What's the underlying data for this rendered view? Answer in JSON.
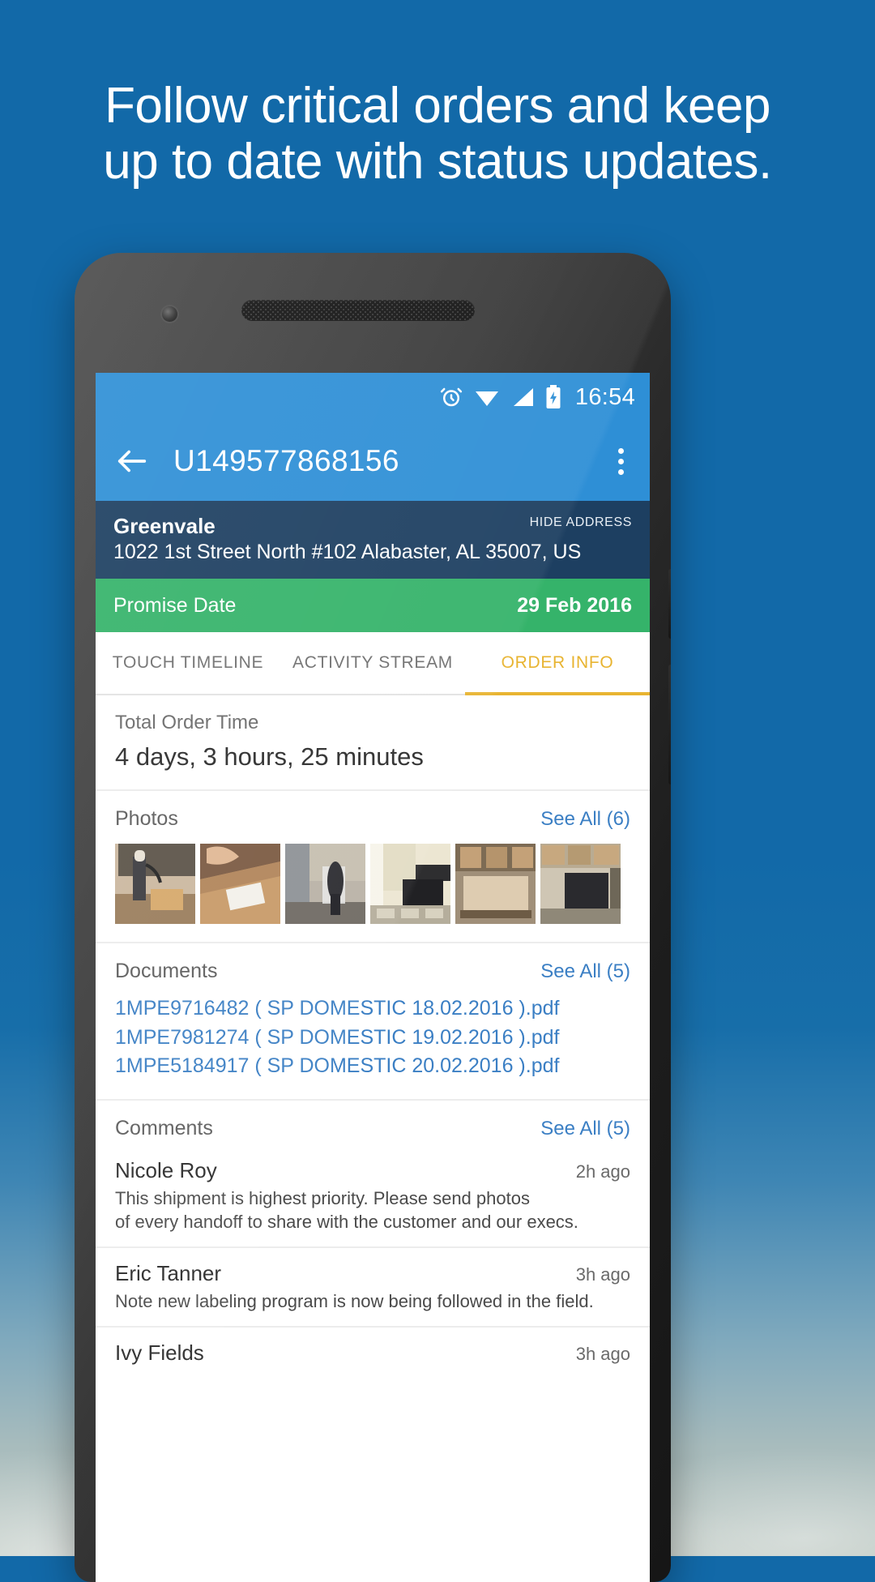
{
  "marketing": {
    "headline_line1": "Follow critical orders and keep",
    "headline_line2": "up to date with status updates."
  },
  "colors": {
    "background": "#1269a8",
    "toolbar": "#2e8fd6",
    "address_bar": "#1d3f61",
    "promise_bar": "#35b36a",
    "accent_tab": "#e8b431",
    "link": "#3b7fc4"
  },
  "statusbar": {
    "alarm_icon": "alarm-clock-icon",
    "wifi_icon": "wifi-icon",
    "signal_icon": "cell-signal-icon",
    "battery_icon": "battery-charging-icon",
    "time": "16:54"
  },
  "toolbar": {
    "back_icon": "back-arrow-icon",
    "title": "U149577868156",
    "overflow_icon": "overflow-menu-icon"
  },
  "address": {
    "name": "Greenvale",
    "line": "1022 1st Street North #102 Alabaster, AL 35007, US",
    "hide_label": "HIDE ADDRESS"
  },
  "promise": {
    "label": "Promise Date",
    "value": "29 Feb 2016"
  },
  "tabs": [
    {
      "label": "TOUCH TIMELINE",
      "active": false
    },
    {
      "label": "ACTIVITY STREAM",
      "active": false
    },
    {
      "label": "ORDER INFO",
      "active": true
    }
  ],
  "total_order_time": {
    "label": "Total Order Time",
    "value": "4 days, 3 hours, 25 minutes"
  },
  "photos": {
    "title": "Photos",
    "see_all": "See All (6)",
    "items": [
      {
        "name": "photo-pallet-jack"
      },
      {
        "name": "photo-box-label"
      },
      {
        "name": "photo-warehouse-cart"
      },
      {
        "name": "photo-loading-dock"
      },
      {
        "name": "photo-wrapped-pallet"
      },
      {
        "name": "photo-stacked-crate"
      }
    ]
  },
  "documents": {
    "title": "Documents",
    "see_all": "See All (5)",
    "items": [
      "1MPE9716482 ( SP DOMESTIC 18.02.2016 ).pdf",
      "1MPE7981274 ( SP DOMESTIC 19.02.2016 ).pdf",
      "1MPE5184917 ( SP DOMESTIC 20.02.2016 ).pdf"
    ]
  },
  "comments": {
    "title": "Comments",
    "see_all": "See All (5)",
    "items": [
      {
        "author": "Nicole Roy",
        "time": "2h ago",
        "body_line1": "This shipment is highest priority. Please send photos",
        "body_line2": "of every handoff to share with the customer and our execs."
      },
      {
        "author": "Eric Tanner",
        "time": "3h ago",
        "body_line1": "Note new labeling program is now being followed in the field.",
        "body_line2": ""
      },
      {
        "author": "Ivy Fields",
        "time": "3h ago",
        "body_line1": "",
        "body_line2": ""
      }
    ]
  }
}
